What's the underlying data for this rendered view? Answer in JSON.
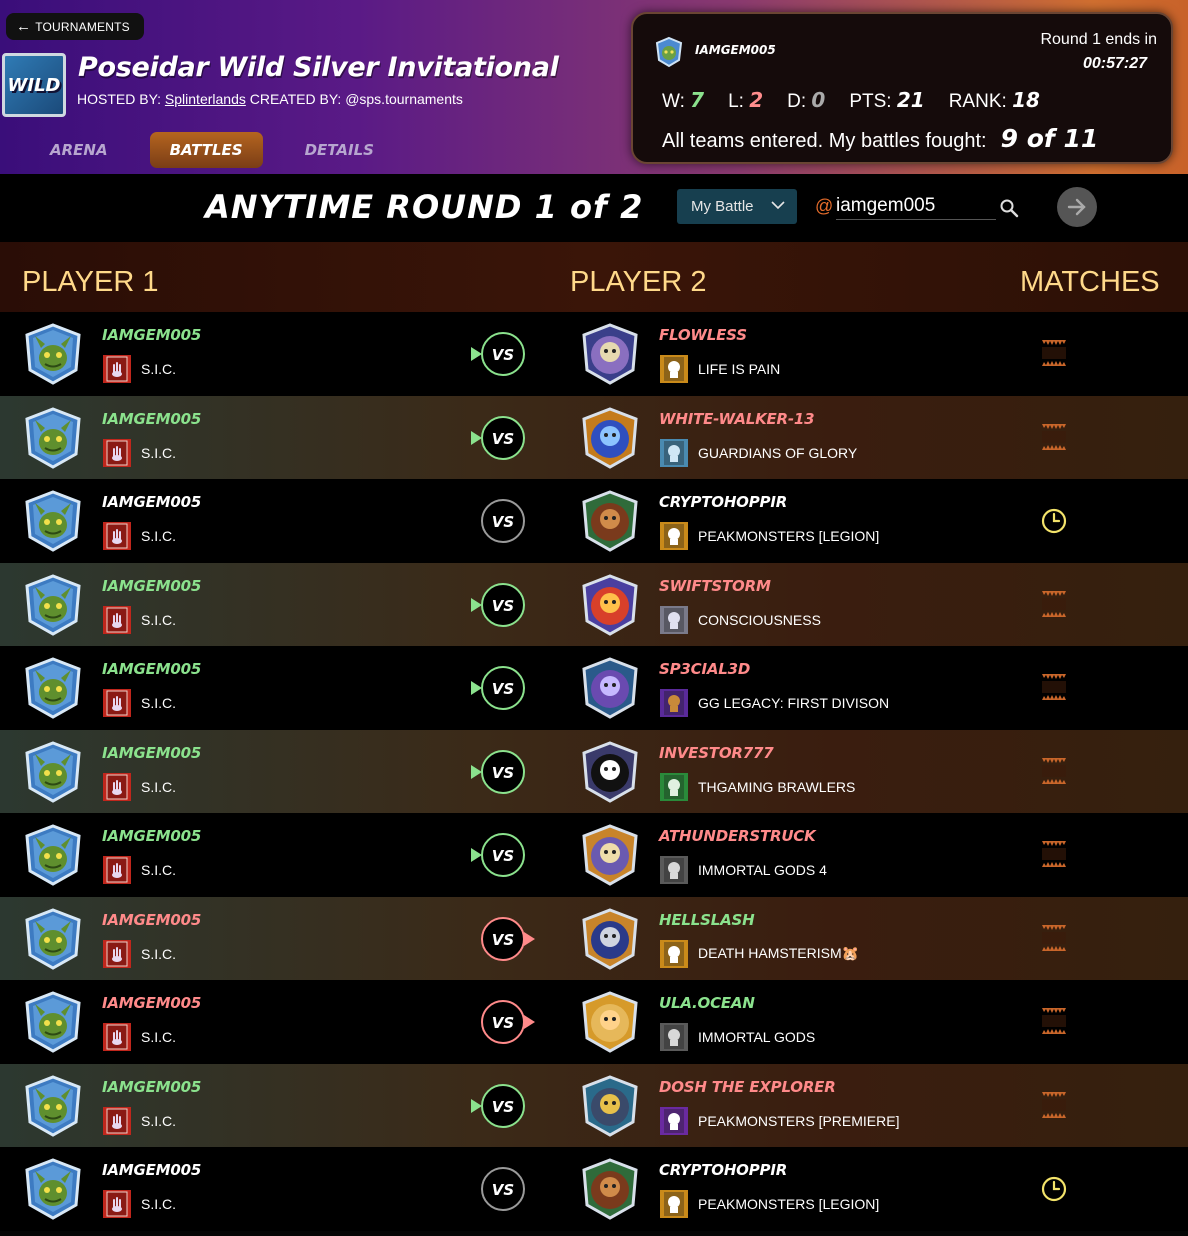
{
  "header": {
    "back_label": "TOURNAMENTS",
    "badge_text": "WILD",
    "title": "Poseidar Wild Silver Invitational",
    "hosted_label": "HOSTED BY:",
    "hosted_by": "Splinterlands",
    "created_label": "CREATED BY:",
    "created_by": "@sps.tournaments",
    "tabs": [
      {
        "label": "ARENA",
        "active": false
      },
      {
        "label": "BATTLES",
        "active": true
      },
      {
        "label": "DETAILS",
        "active": false
      }
    ]
  },
  "stats": {
    "username": "IAMGEM005",
    "round_label": "Round 1 ends in",
    "timer": "00:57:27",
    "wins_label": "W:",
    "wins": "7",
    "losses_label": "L:",
    "losses": "2",
    "draws_label": "D:",
    "draws": "0",
    "pts_label": "PTS:",
    "pts": "21",
    "rank_label": "RANK:",
    "rank": "18",
    "fought_label": "All teams entered. My battles fought:",
    "fought_value": "9 of 11"
  },
  "round": {
    "title": "ANYTIME ROUND 1 of 2",
    "filter_value": "My Battle",
    "at_symbol": "@",
    "search_value": "iamgem005"
  },
  "table": {
    "col_player1": "PLAYER 1",
    "col_player2": "PLAYER 2",
    "col_matches": "MATCHES"
  },
  "colors": {
    "win": "#8be28d",
    "loss": "#ff8a8a",
    "accent": "#e56c2b",
    "header_gold": "#ffd98a"
  },
  "rows": [
    {
      "p1_name": "IAMGEM005",
      "p1_guild": "S.I.C.",
      "p1_result": "win",
      "p2_name": "FLOWLESS",
      "p2_guild": "LIFE IS PAIN",
      "p2_result": "loss",
      "status": "done",
      "shade": "dark",
      "vs_label": "VS",
      "p2_avatar": "wizard",
      "p2_guild_icon": "skull"
    },
    {
      "p1_name": "IAMGEM005",
      "p1_guild": "S.I.C.",
      "p1_result": "win",
      "p2_name": "WHITE-WALKER-13",
      "p2_guild": "GUARDIANS OF GLORY",
      "p2_result": "loss",
      "status": "done",
      "shade": "light",
      "vs_label": "VS",
      "p2_avatar": "ghost",
      "p2_guild_icon": "shield"
    },
    {
      "p1_name": "IAMGEM005",
      "p1_guild": "S.I.C.",
      "p1_result": "pending",
      "p2_name": "CRYPTOHOPPIR",
      "p2_guild": "PEAKMONSTERS [LEGION]",
      "p2_result": "pending",
      "status": "pending",
      "shade": "dark",
      "vs_label": "VS",
      "p2_avatar": "warrior",
      "p2_guild_icon": "skull"
    },
    {
      "p1_name": "IAMGEM005",
      "p1_guild": "S.I.C.",
      "p1_result": "win",
      "p2_name": "SWIFTSTORM",
      "p2_guild": "CONSCIOUSNESS",
      "p2_result": "loss",
      "status": "done",
      "shade": "light",
      "vs_label": "VS",
      "p2_avatar": "fire",
      "p2_guild_icon": "hand"
    },
    {
      "p1_name": "IAMGEM005",
      "p1_guild": "S.I.C.",
      "p1_result": "win",
      "p2_name": "SP3CIAL3D",
      "p2_guild": "GG LEGACY: FIRST DIVISON",
      "p2_result": "loss",
      "status": "done",
      "shade": "dark",
      "vs_label": "VS",
      "p2_avatar": "goblin",
      "p2_guild_icon": "book"
    },
    {
      "p1_name": "IAMGEM005",
      "p1_guild": "S.I.C.",
      "p1_result": "win",
      "p2_name": "INVESTOR777",
      "p2_guild": "THGAMING BRAWLERS",
      "p2_result": "loss",
      "status": "done",
      "shade": "light",
      "vs_label": "VS",
      "p2_avatar": "mouth",
      "p2_guild_icon": "hand-green"
    },
    {
      "p1_name": "IAMGEM005",
      "p1_guild": "S.I.C.",
      "p1_result": "win",
      "p2_name": "ATHUNDERSTRUCK",
      "p2_guild": "IMMORTAL GODS 4",
      "p2_result": "loss",
      "status": "done",
      "shade": "dark",
      "vs_label": "VS",
      "p2_avatar": "wizard-gold",
      "p2_guild_icon": "sword"
    },
    {
      "p1_name": "IAMGEM005",
      "p1_guild": "S.I.C.",
      "p1_result": "loss",
      "p2_name": "HELLSLASH",
      "p2_guild": "DEATH HAMSTERISM🐹",
      "p2_result": "win",
      "status": "done",
      "shade": "light",
      "vs_label": "VS",
      "p2_avatar": "knight",
      "p2_guild_icon": "skull"
    },
    {
      "p1_name": "IAMGEM005",
      "p1_guild": "S.I.C.",
      "p1_result": "loss",
      "p2_name": "ULA.OCEAN",
      "p2_guild": "IMMORTAL GODS",
      "p2_result": "win",
      "status": "done",
      "shade": "dark",
      "vs_label": "VS",
      "p2_avatar": "mermaid",
      "p2_guild_icon": "sword"
    },
    {
      "p1_name": "IAMGEM005",
      "p1_guild": "S.I.C.",
      "p1_result": "win",
      "p2_name": "DOSH THE EXPLORER",
      "p2_guild": "PEAKMONSTERS [PREMIERE]",
      "p2_result": "loss",
      "status": "done",
      "shade": "light",
      "vs_label": "VS",
      "p2_avatar": "explorer",
      "p2_guild_icon": "skull-purple"
    },
    {
      "p1_name": "IAMGEM005",
      "p1_guild": "S.I.C.",
      "p1_result": "pending",
      "p2_name": "CRYPTOHOPPIR",
      "p2_guild": "PEAKMONSTERS [LEGION]",
      "p2_result": "pending",
      "status": "pending",
      "shade": "dark",
      "vs_label": "VS",
      "p2_avatar": "warrior",
      "p2_guild_icon": "skull"
    }
  ]
}
